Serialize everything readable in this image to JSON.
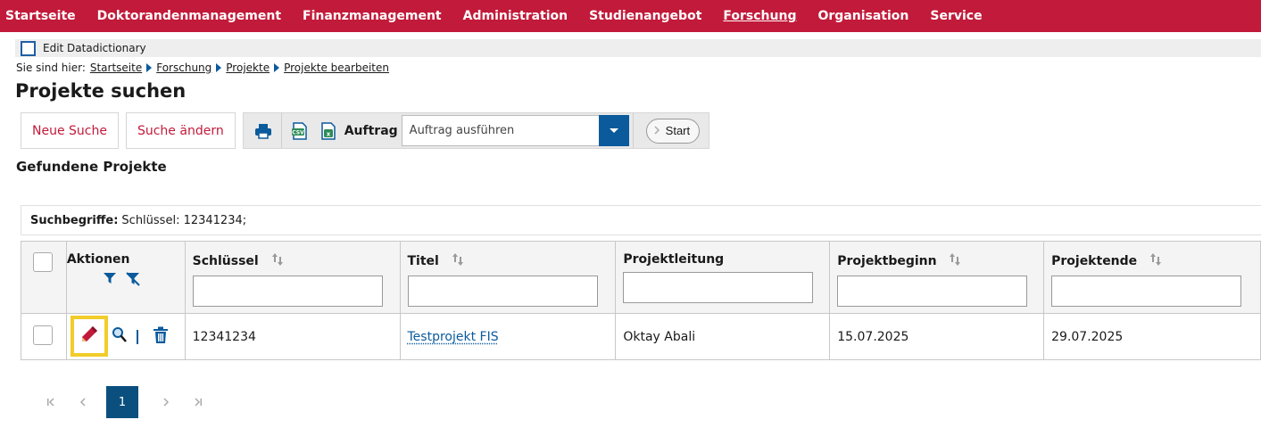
{
  "nav": {
    "items": [
      "Startseite",
      "Doktorandenmanagement",
      "Finanzmanagement",
      "Administration",
      "Studienangebot",
      "Forschung",
      "Organisation",
      "Service"
    ],
    "active": "Forschung",
    "bg_color": "#c21a3a"
  },
  "edit_datadictionary": {
    "label": "Edit Datadictionary",
    "checked": false
  },
  "breadcrumb": {
    "prefix": "Sie sind hier:",
    "items": [
      "Startseite",
      "Forschung",
      "Projekte",
      "Projekte bearbeiten"
    ]
  },
  "page_title": "Projekte suchen",
  "toolbar": {
    "new_search": "Neue Suche",
    "change_search": "Suche ändern",
    "print_icon": "printer-icon",
    "csv_icon": "csv-export-icon",
    "excel_icon": "excel-export-icon",
    "auftrag_label": "Auftrag",
    "auftrag_select": "Auftrag ausführen",
    "start": "Start"
  },
  "section_title": "Gefundene Projekte",
  "search_terms": {
    "label": "Suchbegriffe:",
    "value": "Schlüssel: 12341234;"
  },
  "table": {
    "headers": {
      "actions": "Aktionen",
      "key": "Schlüssel",
      "title": "Titel",
      "lead": "Projektleitung",
      "begin": "Projektbeginn",
      "end": "Projektende"
    },
    "rows": [
      {
        "key": "12341234",
        "title": "Testprojekt FIS",
        "lead": "Oktay Abali",
        "begin": "15.07.2025",
        "end": "29.07.2025"
      }
    ]
  },
  "pagination": {
    "current": "1"
  },
  "colors": {
    "accent": "#c21a3a",
    "link": "#0a5a9c",
    "highlight": "#f2cc2a"
  }
}
